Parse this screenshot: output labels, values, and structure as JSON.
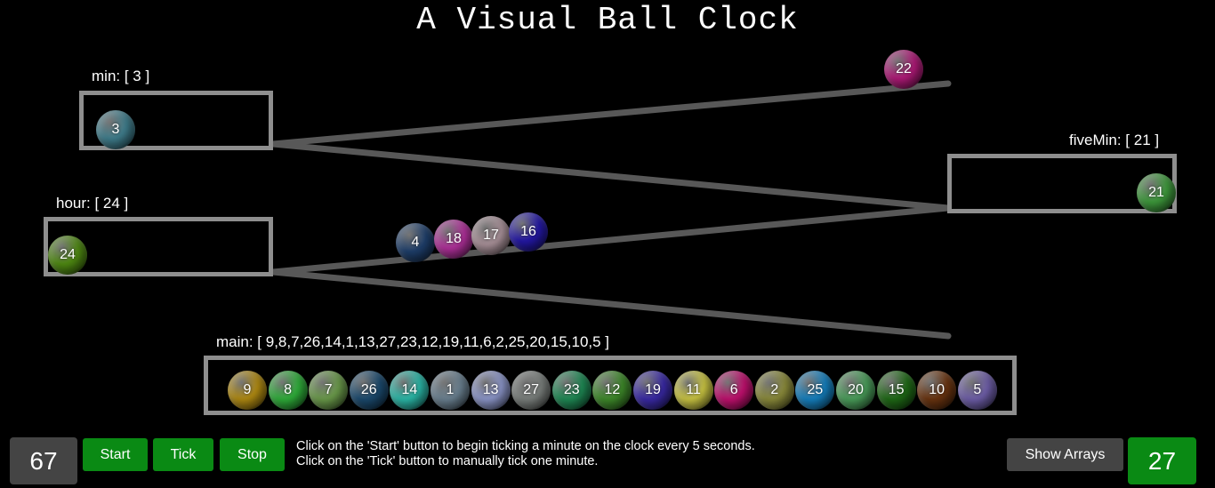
{
  "title": "A Visual Ball Clock",
  "queues": {
    "min": {
      "label": "min: [ 3 ]",
      "balls": [
        {
          "n": "3",
          "c": "#3f7d8c"
        }
      ]
    },
    "hour": {
      "label": "hour: [ 24 ]",
      "balls": [
        {
          "n": "24",
          "c": "#4f8a12"
        }
      ]
    },
    "fiveMin": {
      "label": "fiveMin: [ 21 ]",
      "balls": [
        {
          "n": "21",
          "c": "#3e9a3c"
        }
      ]
    },
    "main": {
      "label": "main: [ 9,8,7,26,14,1,13,27,23,12,19,11,6,2,25,20,15,10,5 ]",
      "balls": [
        {
          "n": "9",
          "c": "#b08a12"
        },
        {
          "n": "8",
          "c": "#2fae3a"
        },
        {
          "n": "7",
          "c": "#6a9a4a"
        },
        {
          "n": "26",
          "c": "#1b4a6e"
        },
        {
          "n": "14",
          "c": "#2bb8a8"
        },
        {
          "n": "1",
          "c": "#6a8090"
        },
        {
          "n": "13",
          "c": "#8b95c8"
        },
        {
          "n": "27",
          "c": "#7a7f7c"
        },
        {
          "n": "23",
          "c": "#1f8a55"
        },
        {
          "n": "12",
          "c": "#3e8a2a"
        },
        {
          "n": "19",
          "c": "#3a2aa6"
        },
        {
          "n": "11",
          "c": "#c9c442"
        },
        {
          "n": "6",
          "c": "#c0106e"
        },
        {
          "n": "2",
          "c": "#8a8a3a"
        },
        {
          "n": "25",
          "c": "#1580bf"
        },
        {
          "n": "20",
          "c": "#4a9e5a"
        },
        {
          "n": "15",
          "c": "#1f6a16"
        },
        {
          "n": "10",
          "c": "#6a3410"
        },
        {
          "n": "5",
          "c": "#6e5ea8"
        }
      ]
    }
  },
  "rolling_balls": [
    {
      "n": "22",
      "c": "#b01a78"
    },
    {
      "n": "4",
      "c": "#1e3e6a"
    },
    {
      "n": "18",
      "c": "#b0309a"
    },
    {
      "n": "17",
      "c": "#a89098"
    },
    {
      "n": "16",
      "c": "#2418a6"
    }
  ],
  "controls": {
    "left_counter": "67",
    "start": "Start",
    "tick": "Tick",
    "stop": "Stop",
    "show_arrays": "Show Arrays",
    "right_counter": "27"
  },
  "instructions": {
    "line1": "Click on the 'Start' button to begin ticking a minute on the clock every 5 seconds.",
    "line2": "Click on the 'Tick' button to manually tick one minute."
  },
  "colors": {
    "track": "#585858",
    "box_border": "#8e8e8e",
    "button_green": "#0a8a14",
    "counter_left_bg": "#444444",
    "counter_right_bg": "#0a8a14",
    "show_arrays_bg": "#444444"
  }
}
